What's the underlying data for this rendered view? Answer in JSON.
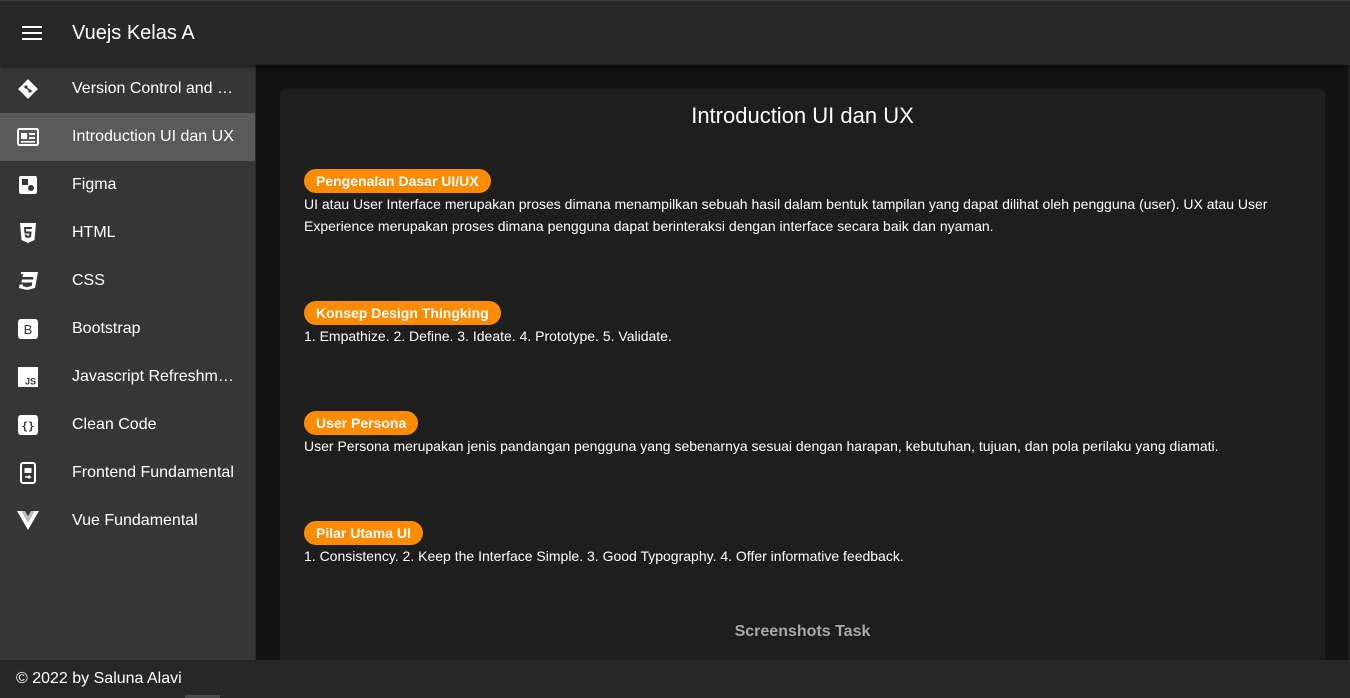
{
  "app": {
    "title": "Vuejs Kelas A"
  },
  "sidebar": {
    "items": [
      {
        "label": "Version Control and B…",
        "icon": "git-icon"
      },
      {
        "label": "Introduction UI dan UX",
        "icon": "newspaper-icon",
        "active": true
      },
      {
        "label": "Figma",
        "icon": "figma-icon"
      },
      {
        "label": "HTML",
        "icon": "html5-icon"
      },
      {
        "label": "CSS",
        "icon": "css3-icon"
      },
      {
        "label": "Bootstrap",
        "icon": "bootstrap-icon"
      },
      {
        "label": "Javascript Refreshme…",
        "icon": "javascript-icon"
      },
      {
        "label": "Clean Code",
        "icon": "code-braces-icon"
      },
      {
        "label": "Frontend Fundamental",
        "icon": "cellphone-link-icon"
      },
      {
        "label": "Vue Fundamental",
        "icon": "vuejs-icon"
      }
    ]
  },
  "content": {
    "title": "Introduction UI dan UX",
    "sections": [
      {
        "chip": "Pengenalan Dasar UI/UX",
        "text": "UI atau User Interface merupakan proses dimana menampilkan sebuah hasil dalam bentuk tampilan yang dapat dilihat oleh pengguna (user). UX atau User Experience merupakan proses dimana pengguna dapat berinteraksi dengan interface secara baik dan nyaman."
      },
      {
        "chip": "Konsep Design Thingking",
        "text": "1. Empathize. 2. Define. 3. Ideate. 4. Prototype. 5. Validate."
      },
      {
        "chip": "User Persona",
        "text": "User Persona merupakan jenis pandangan pengguna yang sebenarnya sesuai dengan harapan, kebutuhan, tujuan, dan pola perilaku yang diamati."
      },
      {
        "chip": "Pilar Utama UI",
        "text": "1. Consistency. 2. Keep the Interface Simple. 3. Good Typography. 4. Offer informative feedback."
      }
    ],
    "screenshots_title": "Screenshots Task"
  },
  "footer": {
    "text": "© 2022 by Saluna Alavi"
  },
  "colors": {
    "accent_chip": "#ff8c00",
    "app_bar": "#272727",
    "sidebar": "#363636",
    "card": "#1e1e1e"
  }
}
